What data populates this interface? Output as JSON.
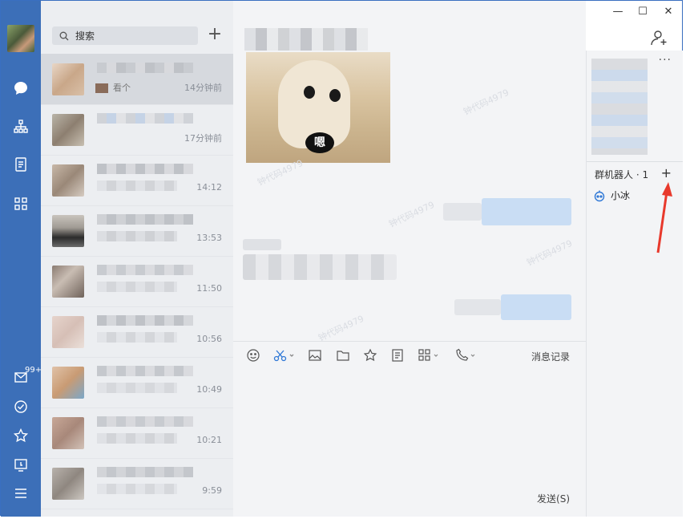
{
  "search": {
    "placeholder": "搜索"
  },
  "chats": [
    {
      "preview": "看个",
      "time": "14分钟前"
    },
    {
      "preview": "",
      "time": "17分钟前"
    },
    {
      "preview": "",
      "time": "14:12"
    },
    {
      "preview": "",
      "time": "13:53"
    },
    {
      "preview": "",
      "time": "11:50"
    },
    {
      "preview": "",
      "time": "10:56"
    },
    {
      "preview": "",
      "time": "10:49"
    },
    {
      "preview": "",
      "time": "10:21"
    },
    {
      "preview": "",
      "time": "9:59"
    }
  ],
  "rail": {
    "mail_badge": "99+"
  },
  "toolbar": {
    "history_label": "消息记录"
  },
  "composer": {
    "send_label": "发送(S)"
  },
  "sidepanel": {
    "robots_label": "群机器人 · 1",
    "robot_name": "小冰",
    "more_label": "···",
    "add_label": "+"
  },
  "image_message": {
    "caption": "嗯"
  },
  "watermark": "钟代码4979",
  "colors": {
    "rail": "#3c6fb8",
    "accent": "#2f78d6",
    "bubble_self": "#c9ddf4",
    "arrow": "#e8392c"
  }
}
